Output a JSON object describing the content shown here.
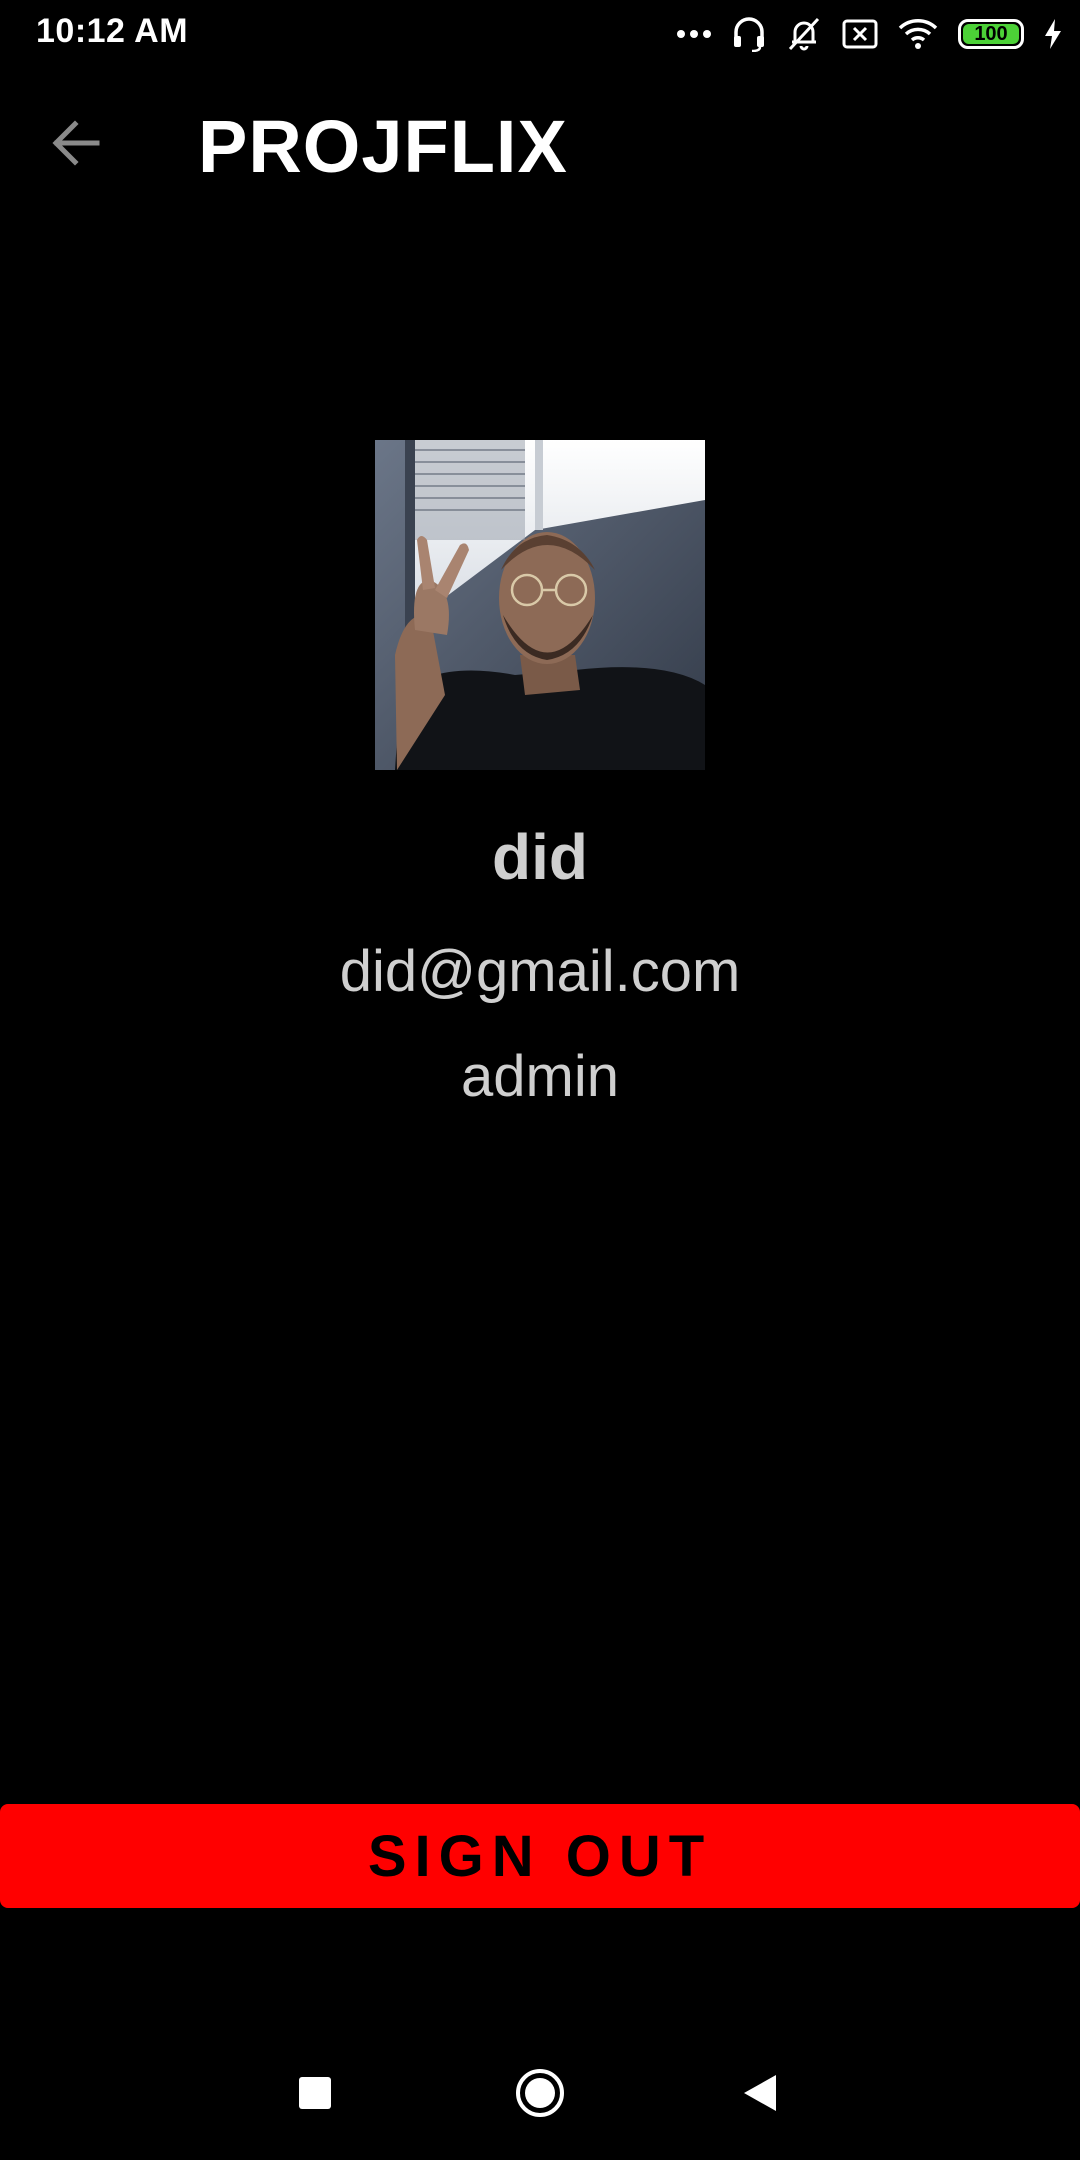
{
  "status_bar": {
    "time": "10:12 AM",
    "battery_level": "100",
    "icons": [
      "more-dots-icon",
      "headset-icon",
      "muted-bell-icon",
      "sim-x-icon",
      "wifi-icon",
      "battery-icon",
      "charging-bolt-icon"
    ]
  },
  "app_bar": {
    "title": "PROJFLIX",
    "back_icon": "arrow-left-icon"
  },
  "profile": {
    "avatar_alt": "profile photo",
    "name": "did",
    "email": "did@gmail.com",
    "role": "admin"
  },
  "actions": {
    "sign_out_label": "SIGN OUT"
  },
  "nav_bar": {
    "buttons": [
      "recents-square-icon",
      "home-circle-icon",
      "back-triangle-icon"
    ]
  },
  "colors": {
    "background": "#000000",
    "accent": "#ff0000",
    "text_primary": "#ffffff",
    "text_secondary": "#cfcfcf",
    "battery": "#4cd137"
  }
}
